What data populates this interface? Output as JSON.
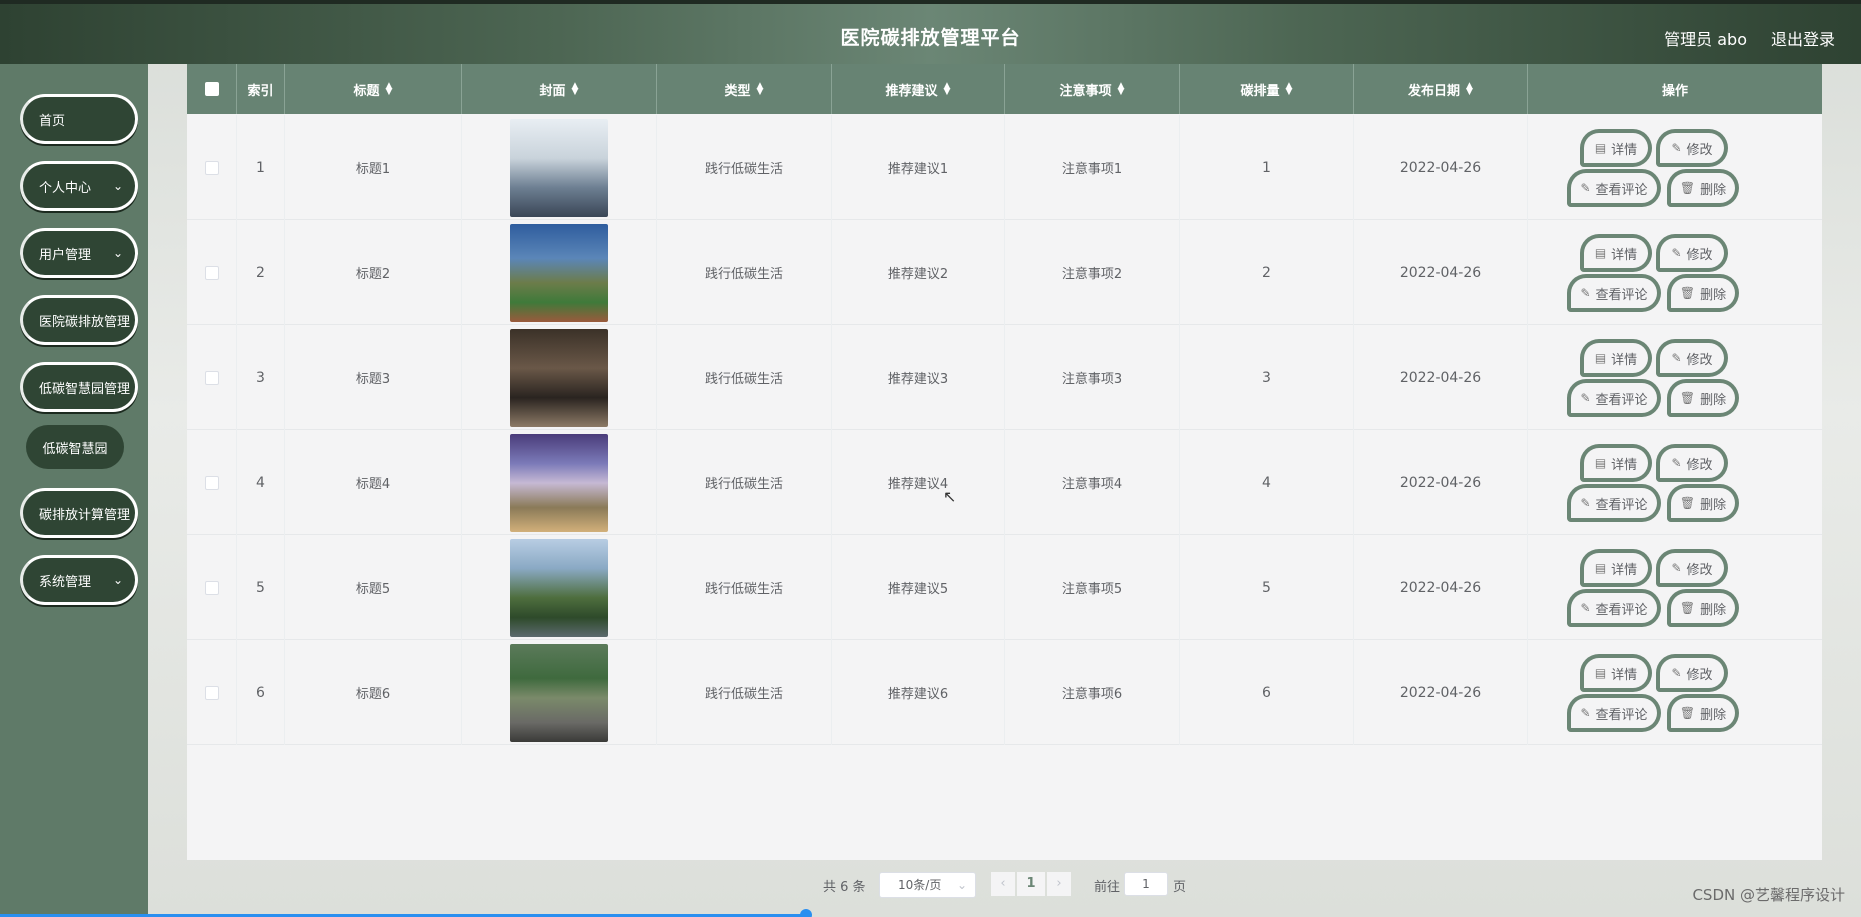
{
  "header": {
    "title": "医院碳排放管理平台",
    "user": "管理员 abo",
    "logout": "退出登录"
  },
  "sidebar": {
    "items": [
      {
        "label": "首页"
      },
      {
        "label": "个人中心"
      },
      {
        "label": "用户管理"
      },
      {
        "label": "医院碳排放管理"
      },
      {
        "label": "低碳智慧园管理"
      },
      {
        "label": "低碳智慧园"
      },
      {
        "label": "碳排放计算管理"
      },
      {
        "label": "系统管理"
      }
    ]
  },
  "table": {
    "headers": {
      "index": "索引",
      "title": "标题",
      "cover": "封面",
      "type": "类型",
      "advice": "推荐建议",
      "notes": "注意事项",
      "carbon": "碳排量",
      "date": "发布日期",
      "actions": "操作"
    },
    "rows": [
      {
        "index": "1",
        "title": "标题1",
        "type": "践行低碳生活",
        "advice": "推荐建议1",
        "notes": "注意事项1",
        "carbon": "1",
        "date": "2022-04-26"
      },
      {
        "index": "2",
        "title": "标题2",
        "type": "践行低碳生活",
        "advice": "推荐建议2",
        "notes": "注意事项2",
        "carbon": "2",
        "date": "2022-04-26"
      },
      {
        "index": "3",
        "title": "标题3",
        "type": "践行低碳生活",
        "advice": "推荐建议3",
        "notes": "注意事项3",
        "carbon": "3",
        "date": "2022-04-26"
      },
      {
        "index": "4",
        "title": "标题4",
        "type": "践行低碳生活",
        "advice": "推荐建议4",
        "notes": "注意事项4",
        "carbon": "4",
        "date": "2022-04-26"
      },
      {
        "index": "5",
        "title": "标题5",
        "type": "践行低碳生活",
        "advice": "推荐建议5",
        "notes": "注意事项5",
        "carbon": "5",
        "date": "2022-04-26"
      },
      {
        "index": "6",
        "title": "标题6",
        "type": "践行低碳生活",
        "advice": "推荐建议6",
        "notes": "注意事项6",
        "carbon": "6",
        "date": "2022-04-26"
      }
    ],
    "action_labels": {
      "detail": "详情",
      "edit": "修改",
      "comments": "查看评论",
      "delete": "删除"
    }
  },
  "pagination": {
    "total": "共 6 条",
    "page_size": "10条/页",
    "current_page": "1",
    "goto_label": "前往",
    "goto_value": "1",
    "page_suffix": "页"
  },
  "watermark": "CSDN @艺馨程序设计",
  "colors": {
    "header_dark": "#2e4232",
    "table_header": "#678373",
    "sidebar_bg": "#5f7a68",
    "menu_item": "#2f4534",
    "accent": "#6b8675"
  }
}
